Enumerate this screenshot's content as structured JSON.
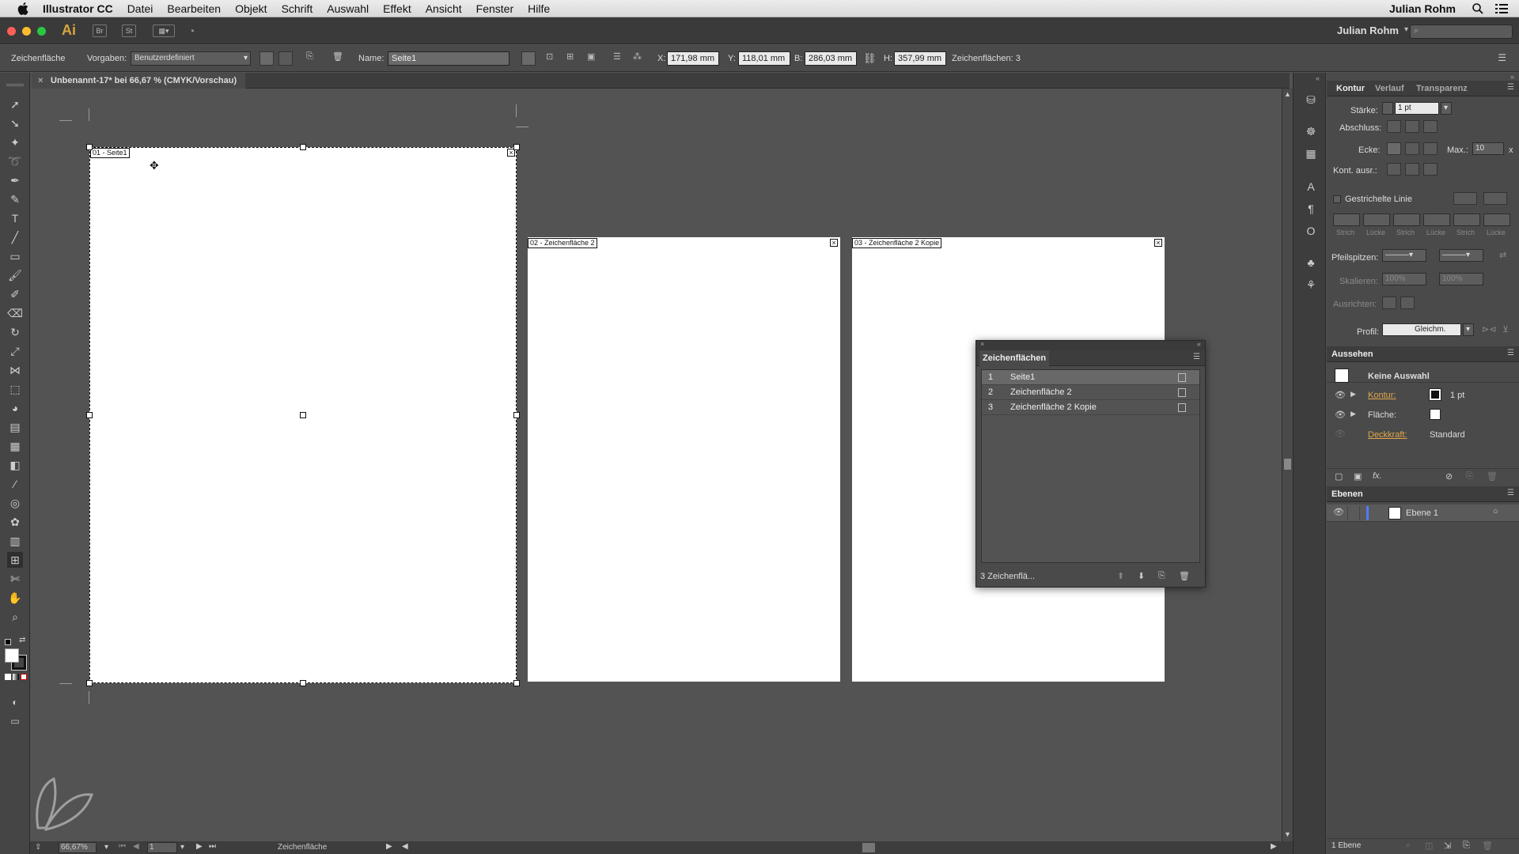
{
  "menubar": {
    "app_name": "Illustrator CC",
    "items": [
      "Datei",
      "Bearbeiten",
      "Objekt",
      "Schrift",
      "Auswahl",
      "Effekt",
      "Ansicht",
      "Fenster",
      "Hilfe"
    ],
    "user": "Julian Rohm"
  },
  "appbar": {
    "logo": "Ai",
    "bridge": "Br",
    "stock": "St",
    "workspace_user": "Julian Rohm"
  },
  "control_bar": {
    "tool_name": "Zeichenfläche",
    "presets_label": "Vorgaben:",
    "presets_value": "Benutzerdefiniert",
    "name_label": "Name:",
    "name_value": "Seite1",
    "x_label": "X:",
    "x_value": "171,98 mm",
    "y_label": "Y:",
    "y_value": "118,01 mm",
    "w_label": "B:",
    "w_value": "286,03 mm",
    "h_label": "H:",
    "h_value": "357,99 mm",
    "count_label": "Zeichenflächen: 3"
  },
  "document_tab": {
    "title": "Unbenannt-17* bei 66,67 % (CMYK/Vorschau)",
    "close": "×"
  },
  "artboards": [
    {
      "label": "01 - Seite1"
    },
    {
      "label": "02 - Zeichenfläche 2"
    },
    {
      "label": "03 - Zeichenfläche 2 Kopie"
    }
  ],
  "status_bar": {
    "zoom": "66,67%",
    "page": "1",
    "tool": "Zeichenfläche"
  },
  "artboards_panel": {
    "title": "Zeichenflächen",
    "rows": [
      {
        "num": "1",
        "name": "Seite1"
      },
      {
        "num": "2",
        "name": "Zeichenfläche 2"
      },
      {
        "num": "3",
        "name": "Zeichenfläche 2 Kopie"
      }
    ],
    "footer": "3 Zeichenflä..."
  },
  "stroke_panel": {
    "tabs": [
      "Kontur",
      "Verlauf",
      "Transparenz"
    ],
    "weight_label": "Stärke:",
    "weight_value": "1 pt",
    "cap_label": "Abschluss:",
    "corner_label": "Ecke:",
    "max_label": "Max.:",
    "max_value": "10",
    "max_unit": "x",
    "align_label": "Kont. ausr.:",
    "dashed_label": "Gestrichelte Linie",
    "dash_headers": [
      "Strich",
      "Lücke",
      "Strich",
      "Lücke",
      "Strich",
      "Lücke"
    ],
    "arrow_label": "Pfeilspitzen:",
    "scale_label": "Skalieren:",
    "scale_value1": "100%",
    "scale_value2": "100%",
    "align_arrow_label": "Ausrichten:",
    "profile_label": "Profil:",
    "profile_value": "Gleichm."
  },
  "appearance_panel": {
    "title": "Aussehen",
    "no_selection": "Keine Auswahl",
    "stroke_label": "Kontur:",
    "stroke_value": "1 pt",
    "fill_label": "Fläche:",
    "opacity_label": "Deckkraft:",
    "opacity_value": "Standard",
    "fx": "fx."
  },
  "layers_panel": {
    "title": "Ebenen",
    "layer_name": "Ebene 1",
    "footer": "1 Ebene"
  },
  "colors": {
    "accent_orange": "#e0a74a",
    "layer_color": "#4f7cff"
  }
}
